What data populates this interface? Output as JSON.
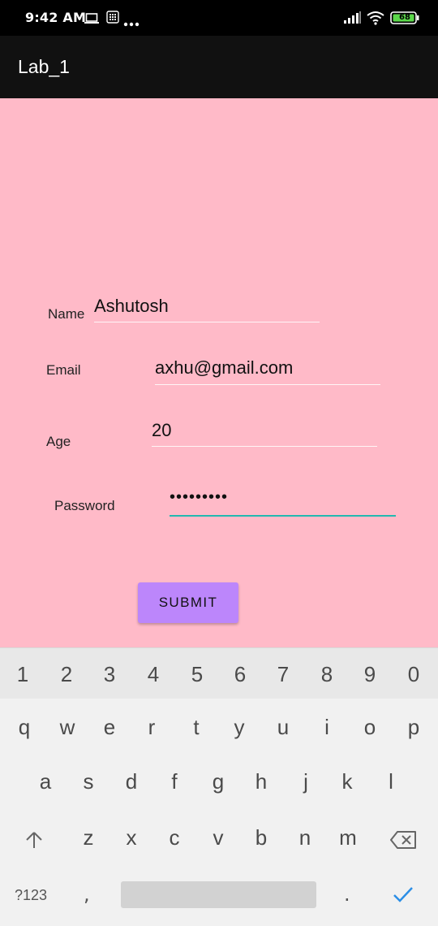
{
  "status_bar": {
    "time": "9:42 AM",
    "battery": "68",
    "icons": [
      "laptop-icon",
      "grid-app-icon",
      "more-dots-icon",
      "signal-icon",
      "wifi-icon",
      "battery-icon"
    ]
  },
  "app_bar": {
    "title": "Lab_1"
  },
  "form": {
    "name_label": "Name",
    "name_value": "Ashutosh",
    "email_label": "Email",
    "email_value": "axhu@gmail.com",
    "age_label": "Age",
    "age_value": "20",
    "password_label": "Password",
    "password_value": "•••••••••",
    "submit_label": "SUBMIT"
  },
  "keyboard": {
    "number_row": [
      "1",
      "2",
      "3",
      "4",
      "5",
      "6",
      "7",
      "8",
      "9",
      "0"
    ],
    "row1": [
      "q",
      "w",
      "e",
      "r",
      "t",
      "y",
      "u",
      "i",
      "o",
      "p"
    ],
    "row2": [
      "a",
      "s",
      "d",
      "f",
      "g",
      "h",
      "j",
      "k",
      "l"
    ],
    "row3": [
      "z",
      "x",
      "c",
      "v",
      "b",
      "n",
      "m"
    ],
    "symbols_label": "?123",
    "comma": ",",
    "period": "."
  },
  "colors": {
    "content_background": "#ffbac8",
    "button": "#bc86fb",
    "focus_underline": "#22b8b0",
    "keyboard_accent": "#2b8ee6"
  }
}
